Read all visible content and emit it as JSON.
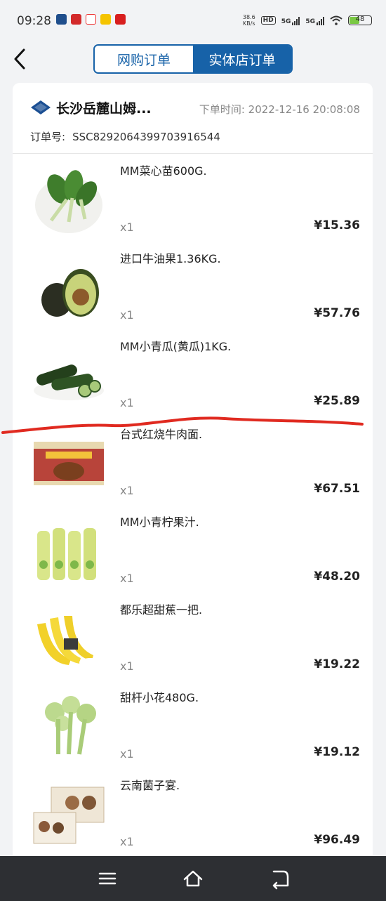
{
  "status_bar": {
    "time": "09:28",
    "net_speed_value": "38.6",
    "net_speed_unit": "KB/s",
    "hd_label": "HD",
    "sim1": "5G",
    "sim2": "5G",
    "battery": "48"
  },
  "header": {
    "tabs": [
      {
        "label": "网购订单",
        "active": false
      },
      {
        "label": "实体店订单",
        "active": true
      }
    ],
    "accent_color": "#1762a8"
  },
  "order": {
    "store_name": "长沙岳麓山姆...",
    "order_time_label": "下单时间: 2022-12-16 20:08:08",
    "order_no_label": "订单号:",
    "order_no": "SSC8292064399703916544",
    "items": [
      {
        "name": "MM菜心苗600G.",
        "qty": "x1",
        "price": "¥15.36",
        "icon": "bok-choy-image"
      },
      {
        "name": "进口牛油果1.36KG.",
        "qty": "x1",
        "price": "¥57.76",
        "icon": "avocado-image"
      },
      {
        "name": "MM小青瓜(黄瓜)1KG.",
        "qty": "x1",
        "price": "¥25.89",
        "icon": "cucumber-image"
      },
      {
        "name": "台式红烧牛肉面.",
        "qty": "x1",
        "price": "¥67.51",
        "icon": "beef-noodle-box-image"
      },
      {
        "name": "MM小青柠果汁.",
        "qty": "x1",
        "price": "¥48.20",
        "icon": "lime-juice-bottles-image"
      },
      {
        "name": "都乐超甜蕉一把.",
        "qty": "x1",
        "price": "¥19.22",
        "icon": "banana-image"
      },
      {
        "name": "甜杆小花480G.",
        "qty": "x1",
        "price": "¥19.12",
        "icon": "broccolini-image"
      },
      {
        "name": "云南菌子宴.",
        "qty": "x1",
        "price": "¥96.49",
        "icon": "mushroom-gift-box-image"
      }
    ]
  },
  "annotation_color": "#e02a20"
}
